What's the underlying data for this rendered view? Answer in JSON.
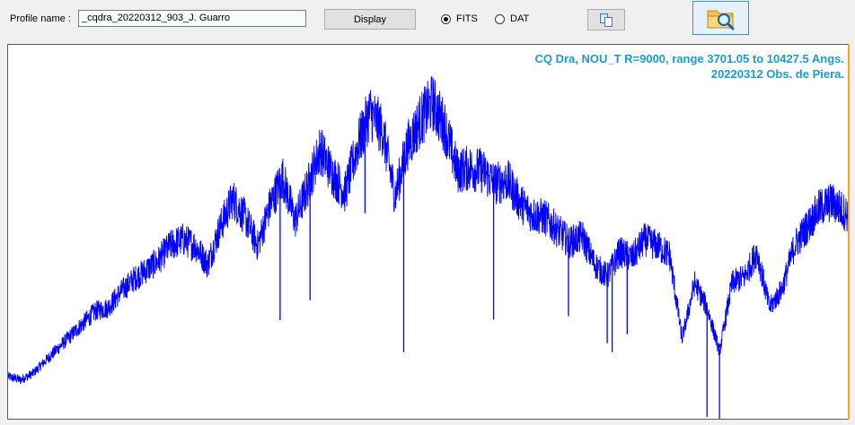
{
  "toolbar": {
    "profile_label": "Profile name :",
    "profile_value": "_cqdra_20220312_903_J. Guarro",
    "display_label": "Display",
    "format_options": [
      {
        "label": "FITS",
        "selected": true
      },
      {
        "label": "DAT",
        "selected": false
      }
    ],
    "copy_icon": "copy-icon",
    "open_icon": "folder-search-icon"
  },
  "plot": {
    "title_line1": "CQ Dra, NOU_T R=9000, range 3701.05 to 10427.5 Angs.",
    "title_line2": "20220312 Obs. de Piera.",
    "title_color": "#1c9bd0",
    "line_color": "#0000ff"
  },
  "chart_data": {
    "type": "line",
    "title": "CQ Dra, NOU_T R=9000, range 3701.05 to 10427.5 Angs.",
    "subtitle": "20220312 Obs. de Piera.",
    "xlim": [
      3701.05,
      10427.5
    ],
    "grid": false,
    "series": [
      {
        "x": [
          3701,
          3800,
          3900,
          4000,
          4100,
          4200,
          4300,
          4400,
          4500,
          4600,
          4700,
          4800,
          4900,
          5000,
          5100,
          5200,
          5300,
          5400,
          5500,
          5600,
          5700,
          5800,
          5900,
          6000,
          6100,
          6200,
          6300,
          6400,
          6500,
          6600,
          6700,
          6800,
          6900,
          7000,
          7100,
          7200,
          7300,
          7400,
          7500,
          7600,
          7700,
          7800,
          7900,
          8000,
          8100,
          8200,
          8300,
          8400,
          8500,
          8600,
          8700,
          8800,
          8900,
          9000,
          9100,
          9200,
          9300,
          9400,
          9500,
          9600,
          9700,
          9800,
          9900,
          10000,
          10100,
          10200,
          10300,
          10427
        ],
        "y": [
          0.08,
          0.07,
          0.09,
          0.13,
          0.17,
          0.21,
          0.25,
          0.29,
          0.3,
          0.35,
          0.39,
          0.42,
          0.45,
          0.5,
          0.52,
          0.5,
          0.44,
          0.56,
          0.65,
          0.59,
          0.5,
          0.63,
          0.72,
          0.58,
          0.69,
          0.81,
          0.73,
          0.67,
          0.82,
          0.93,
          0.87,
          0.66,
          0.82,
          0.9,
          0.96,
          0.88,
          0.74,
          0.75,
          0.74,
          0.7,
          0.71,
          0.64,
          0.6,
          0.59,
          0.55,
          0.51,
          0.53,
          0.44,
          0.4,
          0.48,
          0.46,
          0.52,
          0.5,
          0.47,
          0.2,
          0.38,
          0.3,
          0.16,
          0.38,
          0.4,
          0.48,
          0.3,
          0.36,
          0.5,
          0.56,
          0.62,
          0.64,
          0.6
        ],
        "absorption_lines": [
          {
            "x": 5880,
            "depth": 0.45
          },
          {
            "x": 6120,
            "depth": 0.4
          },
          {
            "x": 6560,
            "depth": 0.3
          },
          {
            "x": 6870,
            "depth": 0.62
          },
          {
            "x": 7590,
            "depth": 0.45
          },
          {
            "x": 8190,
            "depth": 0.25
          },
          {
            "x": 8500,
            "depth": 0.22
          },
          {
            "x": 8540,
            "depth": 0.28
          },
          {
            "x": 8660,
            "depth": 0.26
          },
          {
            "x": 9300,
            "depth": 0.35
          },
          {
            "x": 9400,
            "depth": 0.4
          }
        ]
      }
    ]
  }
}
